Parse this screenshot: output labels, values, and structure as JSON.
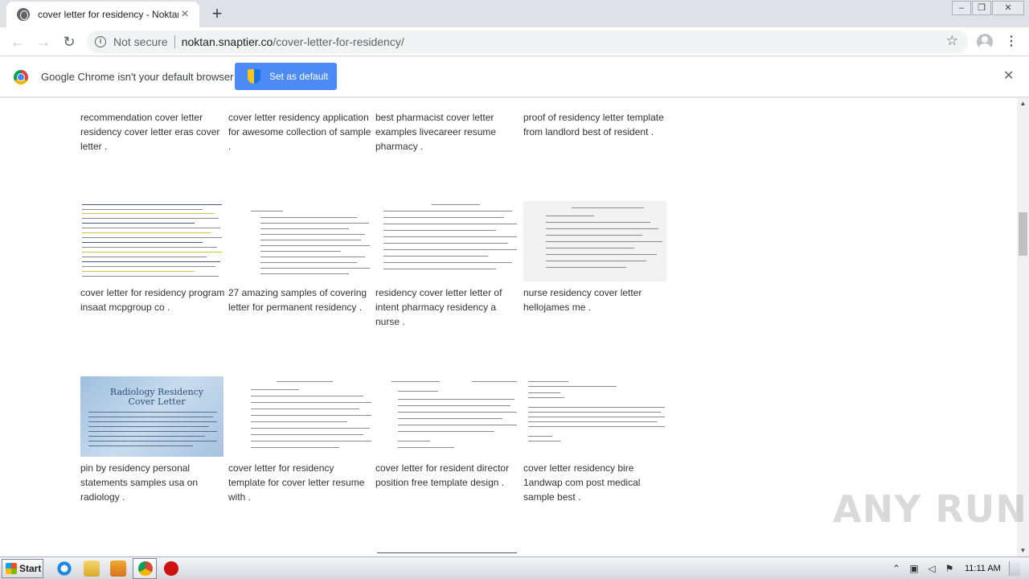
{
  "browser": {
    "tab_title": "cover letter for residency - Noktan.s",
    "new_tab_label": "+",
    "address": {
      "security_label": "Not secure",
      "host": "noktan.snaptier.co",
      "path": "/cover-letter-for-residency/"
    }
  },
  "infobar": {
    "message": "Google Chrome isn't your default browser",
    "button_label": "Set as default",
    "close_label": "✕"
  },
  "gallery": [
    {
      "caption": "recommendation cover letter residency cover letter eras cover letter ."
    },
    {
      "caption": "cover letter residency application for awesome collection of sample ."
    },
    {
      "caption": "best pharmacist cover letter examples livecareer resume pharmacy ."
    },
    {
      "caption": "proof of residency letter template from landlord best of resident ."
    },
    {
      "caption": "cover letter for residency program insaat mcpgroup co ."
    },
    {
      "caption": "27 amazing samples of covering letter for permanent residency ."
    },
    {
      "caption": "residency cover letter letter of intent pharmacy residency a nurse ."
    },
    {
      "caption": "nurse residency cover letter hellojames me ."
    },
    {
      "caption": "pin by residency personal statements samples usa on radiology ."
    },
    {
      "caption": "cover letter for residency template for cover letter resume with ."
    },
    {
      "caption": "cover letter for resident director position free template design ."
    },
    {
      "caption": "cover letter residency bire 1andwap com post medical sample best ."
    }
  ],
  "thumb_text": {
    "radiology": "Radiology Residency Cover Letter"
  },
  "watermark": "ANY RUN",
  "taskbar": {
    "start_label": "Start",
    "clock": "11:11 AM"
  }
}
